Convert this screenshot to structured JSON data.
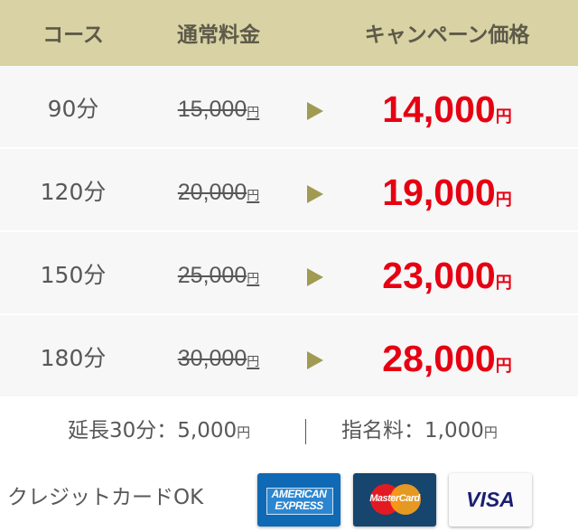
{
  "header": {
    "course": "コース",
    "regular": "通常料金",
    "campaign": "キャンペーン価格"
  },
  "rows": [
    {
      "course": "90分",
      "regular": "15,000",
      "campaign": "14,000"
    },
    {
      "course": "120分",
      "regular": "20,000",
      "campaign": "19,000"
    },
    {
      "course": "150分",
      "regular": "25,000",
      "campaign": "23,000"
    },
    {
      "course": "180分",
      "regular": "30,000",
      "campaign": "28,000"
    }
  ],
  "yen": "円",
  "extension": {
    "label": "延長30分：5,000",
    "yen": "円"
  },
  "nomination": {
    "label": "指名料：1,000",
    "yen": "円"
  },
  "payment": {
    "label": "クレジットカードOK",
    "cards": [
      {
        "icon": "amex-card-icon",
        "text1": "AMERICAN",
        "text2": "EXPRESS"
      },
      {
        "icon": "mastercard-card-icon",
        "text1": "MasterCard"
      },
      {
        "icon": "visa-card-icon",
        "text1": "VISA"
      }
    ]
  },
  "colors": {
    "header_bg": "#d8d2a4",
    "row_bg": "#f7f7f7",
    "price": "#e60012",
    "arrow": "#a09a53",
    "text": "#595757"
  }
}
